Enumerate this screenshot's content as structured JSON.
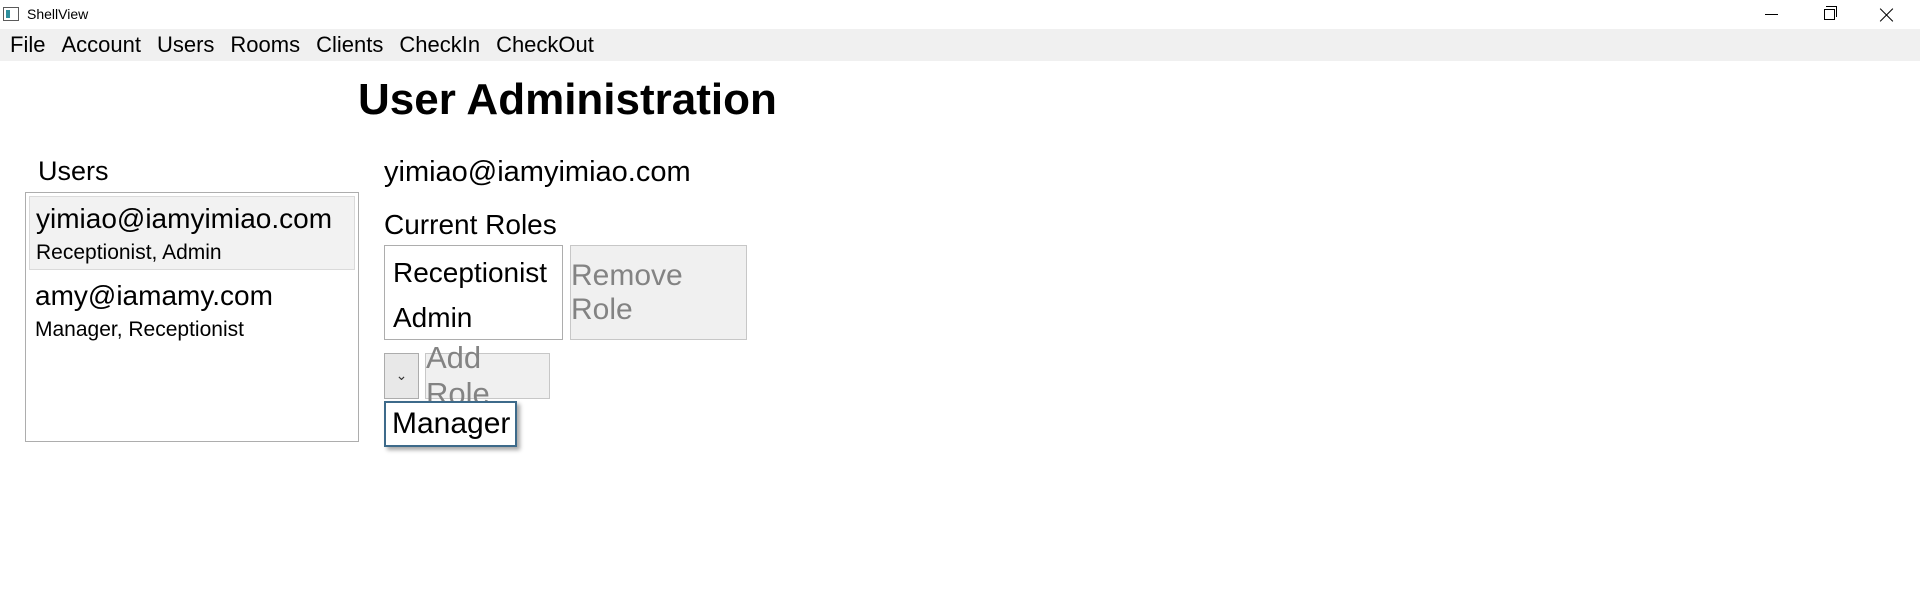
{
  "window": {
    "title": "ShellView"
  },
  "menu": {
    "items": [
      "File",
      "Account",
      "Users",
      "Rooms",
      "Clients",
      "CheckIn",
      "CheckOut"
    ]
  },
  "page": {
    "title": "User Administration"
  },
  "users_panel": {
    "label": "Users",
    "items": [
      {
        "email": "yimiao@iamyimiao.com",
        "roles": "Receptionist, Admin",
        "selected": true
      },
      {
        "email": "amy@iamamy.com",
        "roles": "Manager, Receptionist",
        "selected": false
      }
    ]
  },
  "details": {
    "selected_email": "yimiao@iamyimiao.com",
    "current_roles_label": "Current Roles",
    "current_roles": [
      "Receptionist",
      "Admin"
    ],
    "remove_role_label": "Remove Role",
    "add_role_label": "Add Role",
    "dropdown_options": [
      "Manager"
    ]
  },
  "icons": {
    "app": "app-icon",
    "minimize": "minimize-icon",
    "maximize": "restore-icon",
    "close": "close-icon",
    "combo_arrow": "chevron-down-icon"
  },
  "colors": {
    "menubar_bg": "#f0f0f0",
    "disabled_text": "#838383",
    "dropdown_border": "#3d6a8a"
  }
}
